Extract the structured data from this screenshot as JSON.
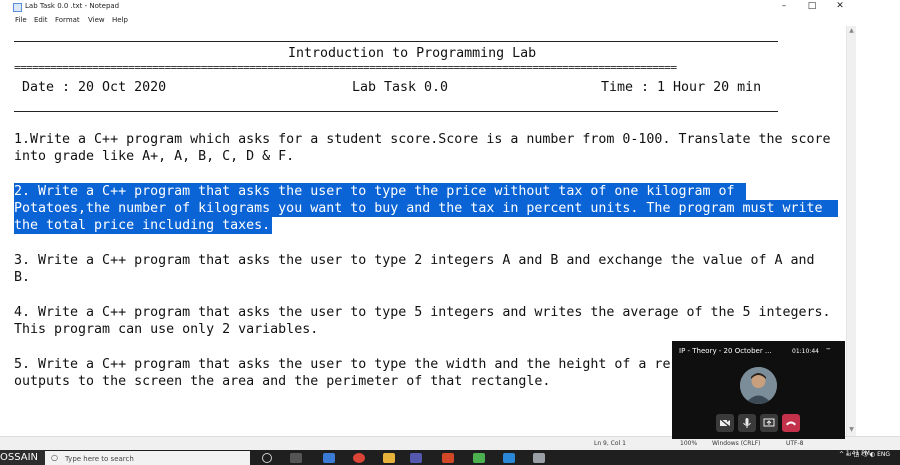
{
  "window": {
    "title": "Lab Task 0.0 .txt - Notepad",
    "minimize_glyph": "–",
    "maximize_glyph": "□",
    "close_glyph": "✕",
    "icon": "notepad-icon"
  },
  "menu": {
    "items": [
      "File",
      "Edit",
      "Format",
      "View",
      "Help"
    ]
  },
  "document": {
    "header_title": "Introduction to Programming Lab",
    "equals_rule": "==============================================================================================================",
    "date": "Date : 20 Oct 2020",
    "task": "Lab Task 0.0",
    "time": "Time : 1 Hour 20 min",
    "questions": [
      {
        "line1": "1.Write a C++ program which asks for a student score.Score is a number from 0-100. Translate the score",
        "line2": "into grade like A+, A, B, C, D & F."
      },
      {
        "line1": "2. Write a C++ program that asks the user to type the price without tax of one kilogram of",
        "line2": "Potatoes,the number of kilograms you want to buy and the tax in percent units. The program must write",
        "line3": "the total price including taxes.",
        "selected": true
      },
      {
        "line1": "3. Write a C++ program that asks the user to type 2 integers A and B and exchange the value of A and",
        "line2": "B."
      },
      {
        "line1": "4. Write a C++ program that asks the user to type 5 integers and writes the average of the 5 integers.",
        "line2": "This program can use only 2 variables."
      },
      {
        "line1": "5. Write a C++ program that asks the user to type the width and the height of a re",
        "line2": "outputs to the screen the area and the perimeter of that rectangle."
      }
    ]
  },
  "status": {
    "position": "Ln 9, Col 1",
    "zoom": "100%",
    "line_ending": "Windows (CRLF)",
    "encoding": "UTF-8"
  },
  "meeting": {
    "title": "IP - Theory - 20 October ...",
    "elapsed": "01:10:44",
    "minimize": "–",
    "controls": [
      "camera-off-icon",
      "microphone-icon",
      "share-screen-icon",
      "hang-up-icon"
    ],
    "hangup_color": "#c4314b"
  },
  "taskbar": {
    "name_tag": "OSSAIN",
    "search_placeholder": "Type here to search",
    "tray_time": "1:41 PM",
    "tray_lang": "ENG",
    "tray_glyphs": "^ ▭ ◫ ◁) ◐"
  },
  "colors": {
    "selection": "#0a64d6",
    "hangup": "#c4314b"
  }
}
